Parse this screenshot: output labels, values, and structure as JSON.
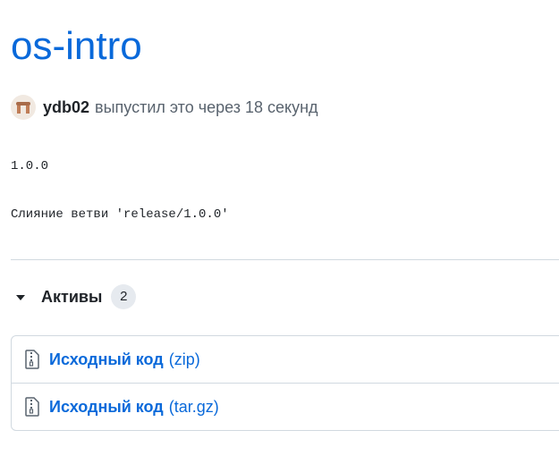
{
  "release": {
    "title": "os-intro",
    "author": "ydb02",
    "published_text": "выпустил это через 18 секунд",
    "body_lines": [
      "1.0.0",
      "Слияние ветви 'release/1.0.0'"
    ]
  },
  "assets": {
    "label": "Активы",
    "count": "2",
    "items": [
      {
        "name": "Исходный код",
        "ext": "(zip)",
        "icon": "file-zip-icon"
      },
      {
        "name": "Исходный код",
        "ext": "(tar.gz)",
        "icon": "file-zip-icon"
      }
    ]
  },
  "colors": {
    "link": "#0969da",
    "border": "#d1d9e0",
    "counter_bg": "#e6eaef"
  }
}
